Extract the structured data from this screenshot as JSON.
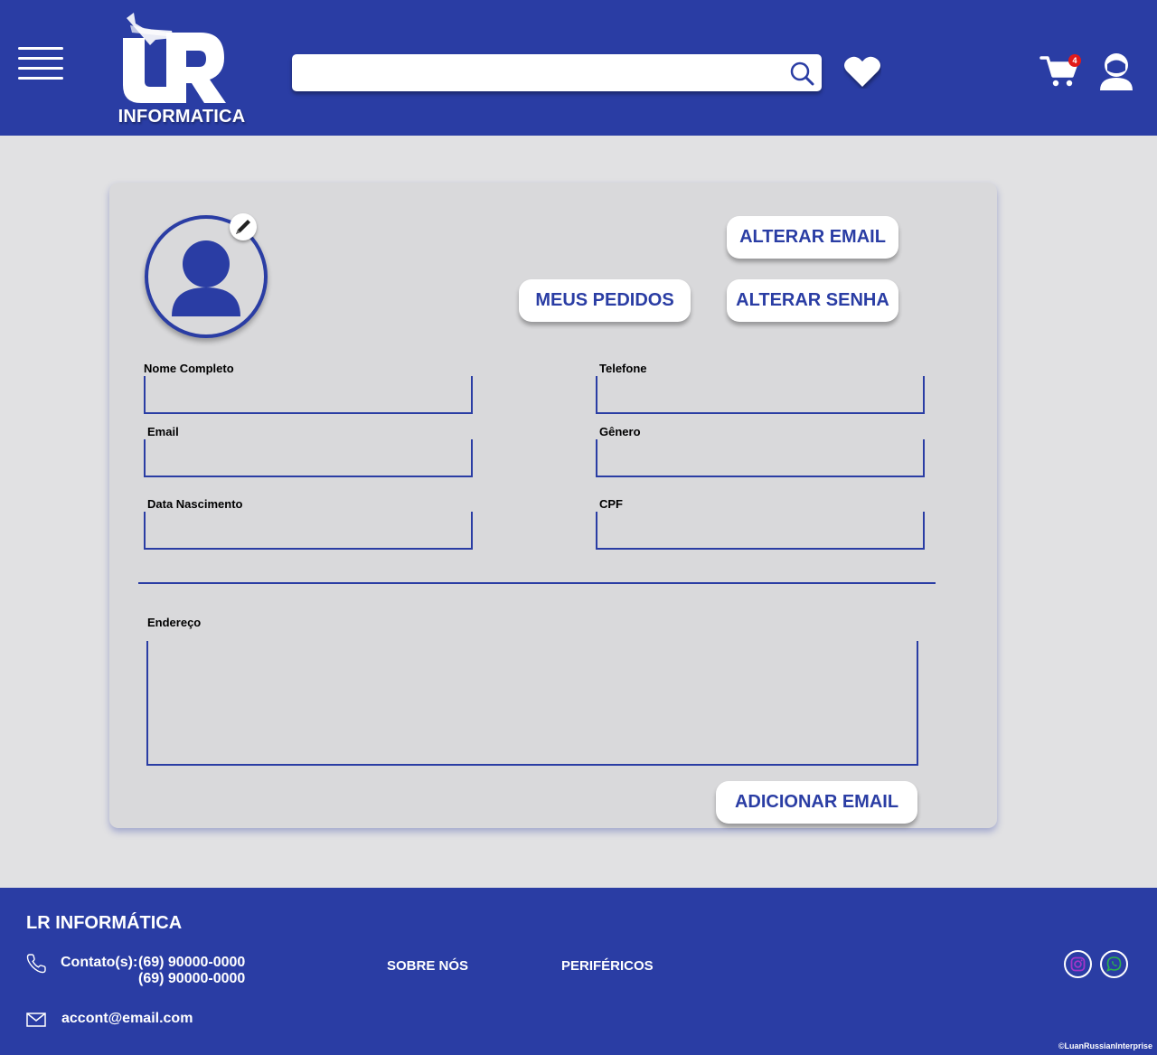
{
  "header": {
    "logo_text": "INFORMATICA",
    "search_value": "",
    "search_placeholder": "",
    "cart_count": "4"
  },
  "profile": {
    "buttons": {
      "change_email": "ALTERAR EMAIL",
      "my_orders": "MEUS PEDIDOS",
      "change_password": "ALTERAR SENHA",
      "add_email": "ADICIONAR EMAIL"
    },
    "fields": {
      "full_name": {
        "label": "Nome Completo",
        "value": ""
      },
      "phone": {
        "label": "Telefone",
        "value": ""
      },
      "email": {
        "label": "Email",
        "value": ""
      },
      "gender": {
        "label": "Gênero",
        "value": ""
      },
      "birth_date": {
        "label": "Data Nascimento",
        "value": ""
      },
      "cpf": {
        "label": "CPF",
        "value": ""
      },
      "address": {
        "label": "Endereço",
        "value": ""
      }
    }
  },
  "footer": {
    "brand": "LR INFORMÁTICA",
    "contact_label": "Contato(s):",
    "phone1": "(69) 90000-0000",
    "phone2": "(69) 90000-0000",
    "email": "accont@email.com",
    "links": [
      "SOBRE NÓS",
      "PERIFÉRICOS"
    ],
    "copyright": "©LuanRussianInterprise"
  },
  "colors": {
    "brand_blue": "#2a3da4",
    "background": "#e1e1e3",
    "card": "#d9d9db",
    "badge_red": "#e21a1a",
    "instagram": "#a335c9",
    "whatsapp": "#2bb34a"
  }
}
